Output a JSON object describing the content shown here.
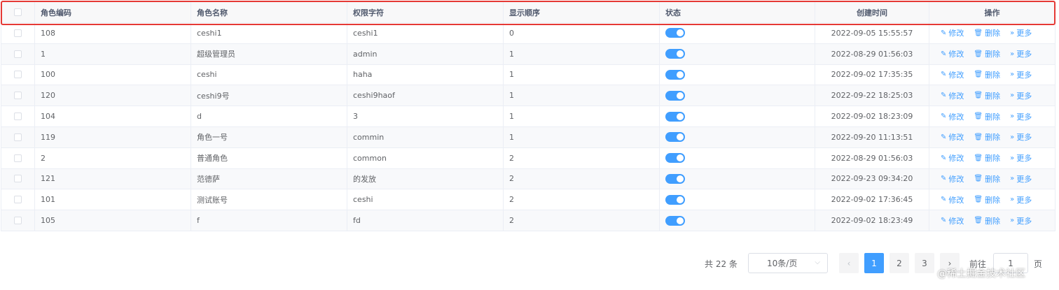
{
  "table": {
    "headers": {
      "code": "角色编码",
      "name": "角色名称",
      "permission": "权限字符",
      "order": "显示顺序",
      "status": "状态",
      "created": "创建时间",
      "ops": "操作"
    },
    "op_labels": {
      "edit": "修改",
      "delete": "删除",
      "more": "更多"
    },
    "rows": [
      {
        "code": "108",
        "name": "ceshi1",
        "permission": "ceshi1",
        "order": "0",
        "status_on": true,
        "created": "2022-09-05 15:55:57"
      },
      {
        "code": "1",
        "name": "超级管理员",
        "permission": "admin",
        "order": "1",
        "status_on": true,
        "created": "2022-08-29 01:56:03"
      },
      {
        "code": "100",
        "name": "ceshi",
        "permission": "haha",
        "order": "1",
        "status_on": true,
        "created": "2022-09-02 17:35:35"
      },
      {
        "code": "120",
        "name": "ceshi9号",
        "permission": "ceshi9haof",
        "order": "1",
        "status_on": true,
        "created": "2022-09-22 18:25:03"
      },
      {
        "code": "104",
        "name": "d",
        "permission": "3",
        "order": "1",
        "status_on": true,
        "created": "2022-09-02 18:23:09"
      },
      {
        "code": "119",
        "name": "角色一号",
        "permission": "commin",
        "order": "1",
        "status_on": true,
        "created": "2022-09-20 11:13:51"
      },
      {
        "code": "2",
        "name": "普通角色",
        "permission": "common",
        "order": "2",
        "status_on": true,
        "created": "2022-08-29 01:56:03"
      },
      {
        "code": "121",
        "name": "范德萨",
        "permission": "的发放",
        "order": "2",
        "status_on": true,
        "created": "2022-09-23 09:34:20"
      },
      {
        "code": "101",
        "name": "测试账号",
        "permission": "ceshi",
        "order": "2",
        "status_on": true,
        "created": "2022-09-02 17:36:45"
      },
      {
        "code": "105",
        "name": "f",
        "permission": "fd",
        "order": "2",
        "status_on": true,
        "created": "2022-09-02 18:23:49"
      }
    ]
  },
  "pagination": {
    "total": "共 22 条",
    "page_size": "10条/页",
    "prev": "‹",
    "pages": [
      "1",
      "2",
      "3"
    ],
    "current_page": "1",
    "next": "›",
    "goto_label": "前往",
    "goto_value": "1",
    "page_suffix": "页"
  },
  "watermark": "@稀土掘金技术社区",
  "colors": {
    "accent": "#409eff",
    "highlight": "#e53935"
  }
}
